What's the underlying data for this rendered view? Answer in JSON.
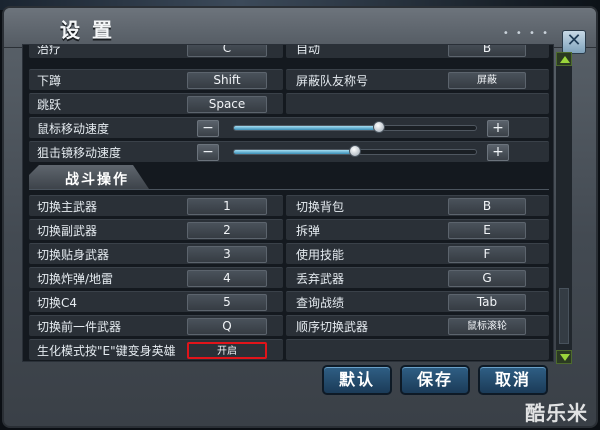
{
  "window": {
    "title": "设置",
    "title_dots": "• • • •",
    "close_label": "✕"
  },
  "rows_top": [
    {
      "left_label": "治疗",
      "left_key": "C",
      "right_label": "自动",
      "right_key": "B"
    },
    {
      "left_label": "下蹲",
      "left_key": "Shift",
      "right_label": "屏蔽队友称号",
      "right_key": "屏蔽"
    },
    {
      "left_label": "跳跃",
      "left_key": "Space",
      "right_label": "",
      "right_key": ""
    }
  ],
  "sliders": [
    {
      "label": "鼠标移动速度",
      "minus": "−",
      "plus": "+",
      "value": 0.6
    },
    {
      "label": "狙击镜移动速度",
      "minus": "−",
      "plus": "+",
      "value": 0.5
    }
  ],
  "section": {
    "title": "战斗操作"
  },
  "rows_combat": [
    {
      "left_label": "切换主武器",
      "left_key": "1",
      "right_label": "切换背包",
      "right_key": "B"
    },
    {
      "left_label": "切换副武器",
      "left_key": "2",
      "right_label": "拆弹",
      "right_key": "E"
    },
    {
      "left_label": "切换贴身武器",
      "left_key": "3",
      "right_label": "使用技能",
      "right_key": "F"
    },
    {
      "left_label": "切换炸弹/地雷",
      "left_key": "4",
      "right_label": "丢弃武器",
      "right_key": "G"
    },
    {
      "left_label": "切换C4",
      "left_key": "5",
      "right_label": "查询战绩",
      "right_key": "Tab"
    },
    {
      "left_label": "切换前一件武器",
      "left_key": "Q",
      "right_label": "顺序切换武器",
      "right_key": "鼠标滚轮"
    },
    {
      "left_label": "生化模式按\"E\"键变身英雄",
      "left_key": "开启",
      "right_label": "",
      "right_key": ""
    }
  ],
  "footer": {
    "default_label": "默认",
    "save_label": "保存",
    "cancel_label": "取消"
  },
  "watermark": "酷乐米",
  "colors": {
    "accent": "#2f5f85",
    "highlight": "#e0141a",
    "slider_fill": "#3b8fb6"
  }
}
